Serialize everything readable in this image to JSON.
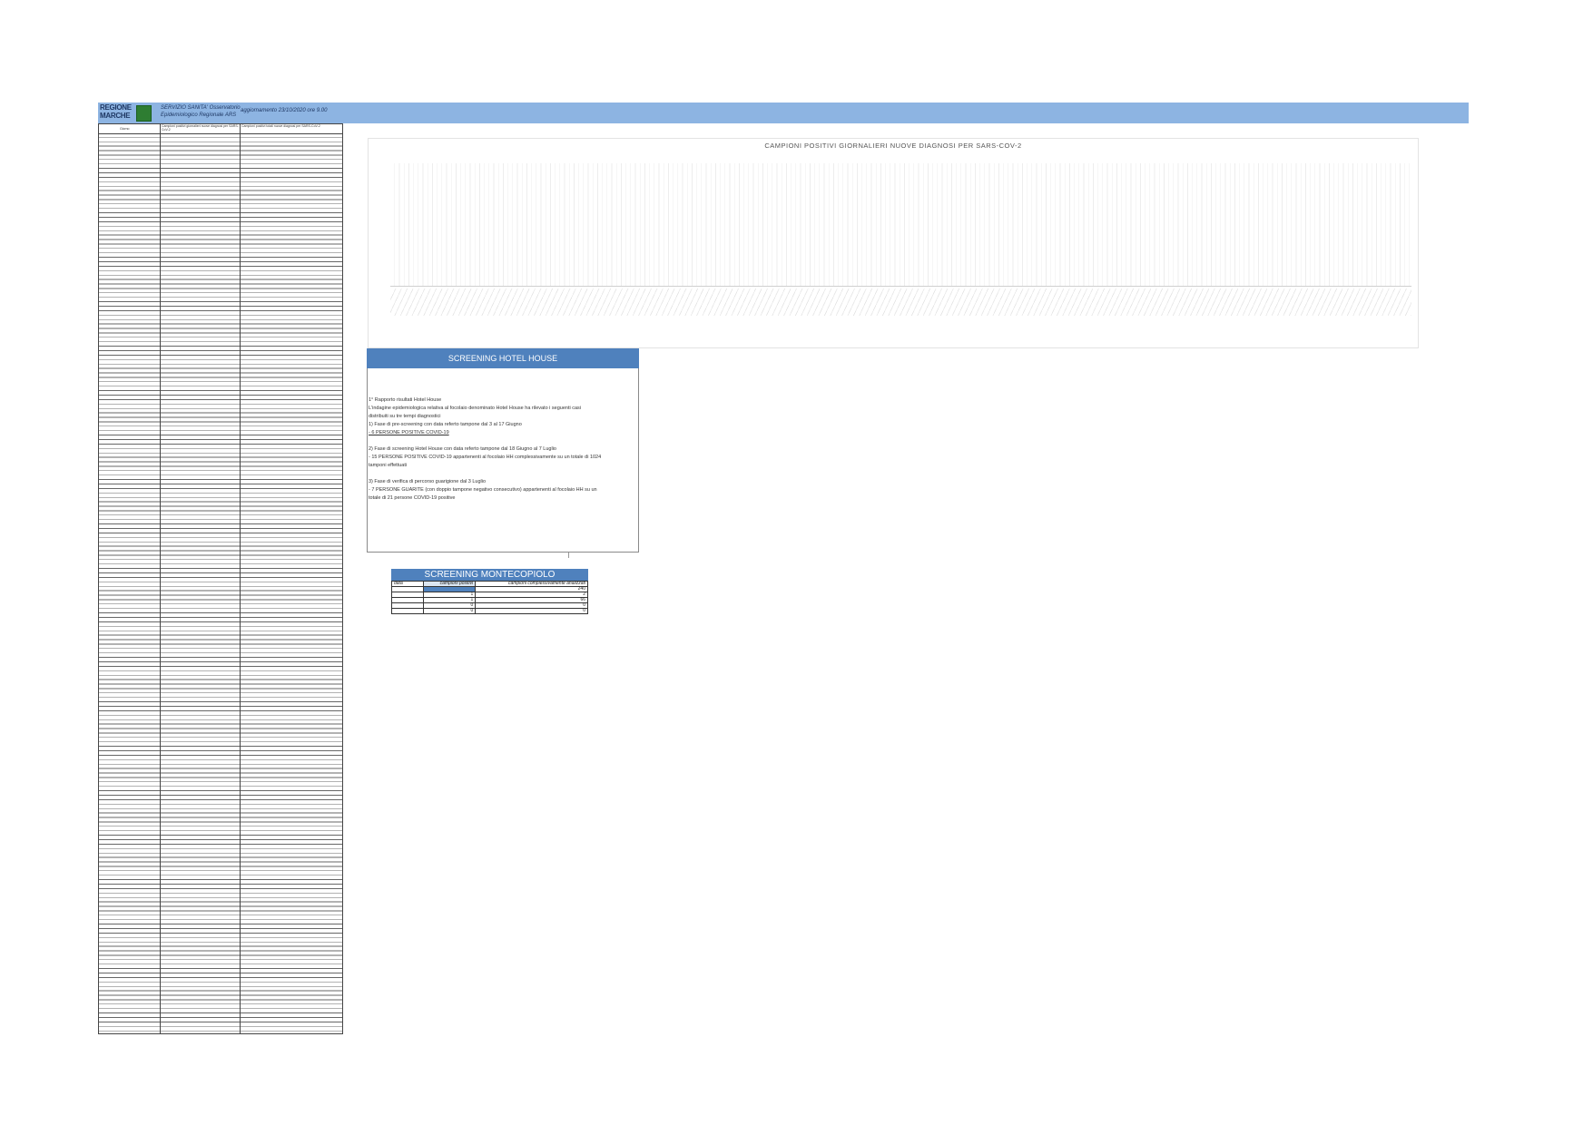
{
  "header": {
    "logo_line1": "REGIONE",
    "logo_line2": "MARCHE",
    "service_line1": "SERVIZIO SANITA' Osservatorio",
    "service_line2": "Epidemiologico Regionale ARS",
    "updated": "aggiornamento 23/10/2020 ore 9.00"
  },
  "left_table": {
    "col1": "Giorno",
    "col2": "Campioni positivi giornalieri nuove diagnosi per SARS-CoV-2",
    "col3": "Campioni positivi totali nuove diagnosi per SARS-CoV-2"
  },
  "chart_data": {
    "type": "bar",
    "title": "CAMPIONI POSITIVI GIORNALIERI NUOVE DIAGNOSI PER SARS-COV-2",
    "xlabel": "",
    "ylabel": "",
    "grid": true,
    "legend": "none"
  },
  "hotel_house": {
    "title": "SCREENING HOTEL HOUSE",
    "lines": [
      "1° Rapporto risultati Hotel House",
      "L'indagine epidemiologica relativa al focolaio denominato Hotel House ha rilevato i seguenti casi",
      "distribuiti su tre tempi diagnostici",
      "1) Fase di pre-screening con data referto tampone dal 3 al 17 Giugno",
      "- 6 PERSONE POSITIVE COVID-19",
      "",
      "2) Fase di screening Hotel House con data referto tampone dal 18 Giugno al 7 Luglio",
      "- 15 PERSONE POSITIVE COVID-19 appartenenti al focolaio HH complessivamente su un totale di 1024",
      "tamponi effettuati",
      "",
      "3) Fase di verifica di percorso guarigione dal 3 Luglio",
      "- 7 PERSONE GUARITE (con doppio tampone negativo consecutivo) appartenenti al focolaio HH su un",
      "totale di 21 persone COVID-19 positive"
    ]
  },
  "montecopiolo": {
    "title": "SCREENING MONTECOPIOLO",
    "headers": [
      "data",
      "campioni positivi",
      "campioni complessivamente analizzati"
    ],
    "values": [
      [
        "",
        "",
        "240"
      ],
      [
        "",
        "1",
        "2"
      ],
      [
        "",
        "1",
        "66"
      ],
      [
        "",
        "0",
        "0"
      ],
      [
        "",
        "0",
        "0"
      ]
    ]
  }
}
